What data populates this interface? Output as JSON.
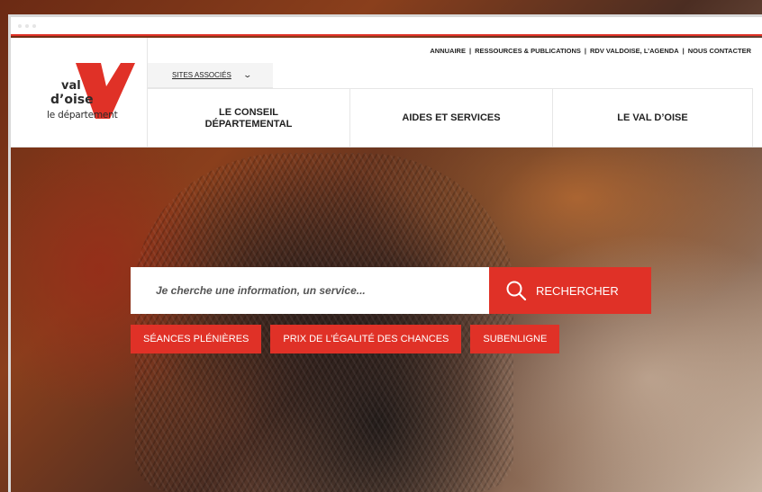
{
  "brand": {
    "logo_line1": "val",
    "logo_line2": "d’oise",
    "logo_line3": "le département",
    "accent_color": "#e03127"
  },
  "top_links": [
    "ANNUAIRE",
    "RESSOURCES & PUBLICATIONS",
    "RDV VALDOISE, L’AGENDA",
    "NOUS CONTACTER"
  ],
  "top_links_separator": "|",
  "sites": {
    "label": "SITES ASSOCIÉS",
    "icon": "chevron-down-icon"
  },
  "nav": {
    "items": [
      {
        "label_line1": "LE CONSEIL",
        "label_line2": "DÉPARTEMENTAL"
      },
      {
        "label": "AIDES ET SERVICES"
      },
      {
        "label": "LE VAL D’OISE"
      }
    ]
  },
  "search": {
    "placeholder": "Je cherche une information, un service...",
    "button_label": "RECHERCHER",
    "button_icon": "search-icon"
  },
  "quick_tags": [
    "SÉANCES PLÉNIÈRES",
    "PRIX DE L’ÉGALITÉ DES CHANCES",
    "SUBENLIGNE"
  ]
}
